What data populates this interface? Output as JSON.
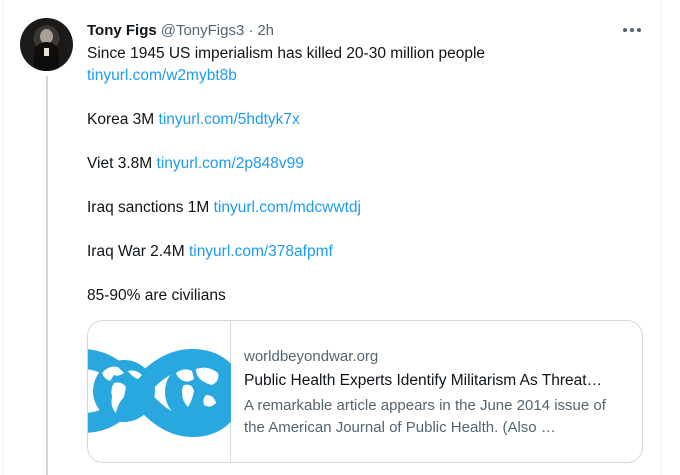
{
  "tweet": {
    "author_name": "Tony Figs",
    "author_handle": "@TonyFigs3",
    "separator": "·",
    "timestamp": "2h",
    "avatar_icon": "profile-photo",
    "more_icon": "more-horizontal-icon",
    "lines": [
      {
        "text": "Since 1945 US imperialism has killed 20-30 million people",
        "link": ""
      },
      {
        "text": "",
        "link": "tinyurl.com/w2mybt8b"
      },
      {
        "text": "Korea 3M",
        "link": "tinyurl.com/5hdtyk7x"
      },
      {
        "text": "Viet 3.8M",
        "link": "tinyurl.com/2p848v99"
      },
      {
        "text": "Iraq sanctions 1M",
        "link": "tinyurl.com/mdcwwtdj"
      },
      {
        "text": "Iraq War 2.4M",
        "link": "tinyurl.com/378afpmf"
      },
      {
        "text": "85-90% are civilians",
        "link": ""
      }
    ]
  },
  "card": {
    "image_icon": "world-beyond-war-logo",
    "domain": "worldbeyondwar.org",
    "title": "Public Health Experts Identify Militarism As Threat…",
    "description": "A remarkable article appears in the June 2014 issue of the American Journal of Public Health.  (Also …"
  },
  "colors": {
    "link": "#1d9bf0",
    "text": "#0f1419",
    "secondary": "#536471",
    "border": "#cfd9de",
    "logo": "#29a8e0"
  }
}
